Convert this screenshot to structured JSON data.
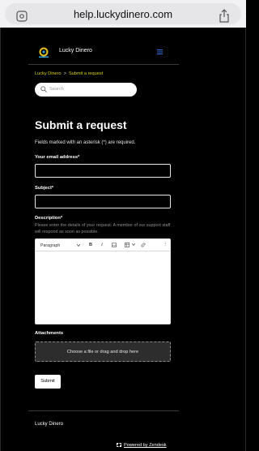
{
  "browser": {
    "url": "help.luckydinero.com"
  },
  "header": {
    "brand": "Lucky Dinero"
  },
  "breadcrumb": {
    "items": [
      "Lucky Dinero",
      "Submit a request"
    ],
    "separator": ">"
  },
  "search": {
    "placeholder": "Search"
  },
  "form": {
    "title": "Submit a request",
    "required_note": "Fields marked with an asterisk (*) are required.",
    "email_label": "Your email address*",
    "subject_label": "Subject*",
    "description_label": "Description*",
    "description_help": "Please enter the details of your request. A member of our support staff will respond as soon as possible.",
    "editor": {
      "paragraph_label": "Paragraph",
      "bold": "B",
      "italic": "I",
      "more": "⋮"
    },
    "attachments_label": "Attachments",
    "dropzone_text": "Choose a file or drag and drop here",
    "submit_label": "Submit"
  },
  "footer": {
    "brand": "Lucky Dinero",
    "powered_by": "Powered by Zendesk"
  },
  "colors": {
    "accent": "#d6d21a",
    "background": "#000000",
    "menu_icon": "#2f6fd6"
  }
}
